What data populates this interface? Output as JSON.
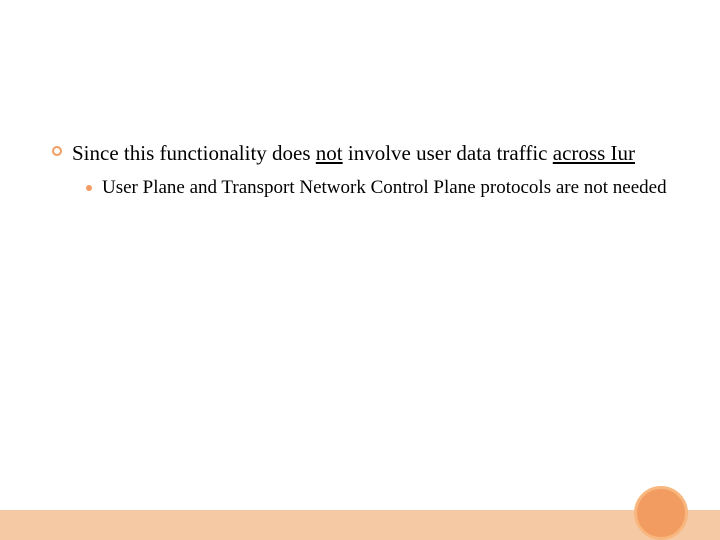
{
  "list": {
    "item1": {
      "text_pre": "Since this functionality does ",
      "u1": "not",
      "text_mid": " involve user data traffic ",
      "u2": "across Iur"
    },
    "sub1": {
      "text": "User Plane and Transport Network Control Plane protocols are not needed"
    }
  }
}
